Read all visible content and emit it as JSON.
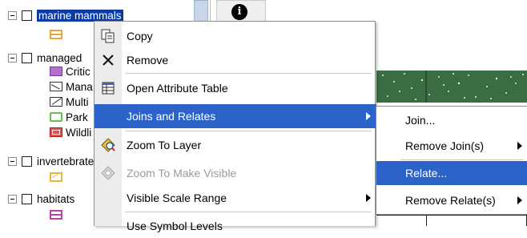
{
  "toc": {
    "layers": [
      {
        "name": "marine mammals",
        "selected": true
      },
      {
        "name": "managed"
      },
      {
        "name": "invertebrates"
      },
      {
        "name": "habitats"
      }
    ],
    "legend_labels": [
      "Critic",
      "Mana",
      "Multi",
      "Park",
      "Wildli"
    ]
  },
  "context_menu": {
    "copy": "Copy",
    "remove": "Remove",
    "open_attribute_table": "Open Attribute Table",
    "joins_and_relates": "Joins and Relates",
    "zoom_to_layer": "Zoom To Layer",
    "zoom_to_make_visible": "Zoom To Make Visible",
    "visible_scale_range": "Visible Scale Range",
    "use_symbol_levels": "Use Symbol Levels"
  },
  "submenu": {
    "join": "Join...",
    "remove_joins": "Remove Join(s)",
    "relate": "Relate...",
    "remove_relates": "Remove Relate(s)"
  },
  "colors": {
    "selection": "#0a3ba8",
    "menu_highlight": "#2c63c8",
    "map_green": "#3b6d43"
  }
}
